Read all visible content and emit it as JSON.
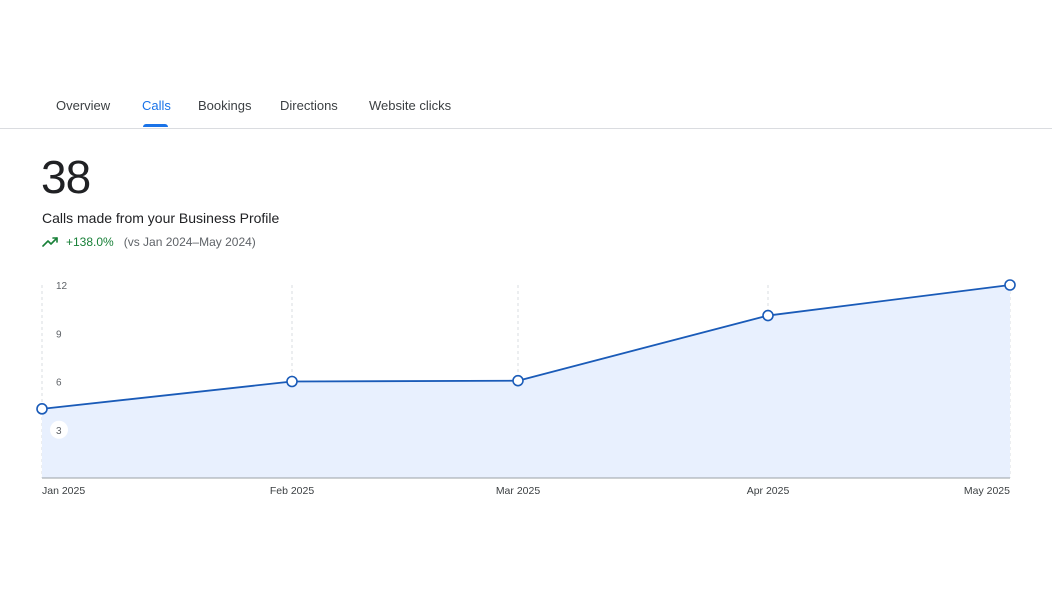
{
  "tabs": [
    {
      "label": "Overview",
      "active": false
    },
    {
      "label": "Calls",
      "active": true
    },
    {
      "label": "Bookings",
      "active": false
    },
    {
      "label": "Directions",
      "active": false
    },
    {
      "label": "Website clicks",
      "active": false
    }
  ],
  "metric": {
    "value": "38",
    "label": "Calls made from your Business Profile",
    "change": "+138.0%",
    "comparison": "(vs Jan 2024–May 2024)",
    "trend_icon": "trending-up-icon"
  },
  "colors": {
    "accent": "#1a73e8",
    "line": "#1a5bb8",
    "area": "#e8f0fe",
    "positive": "#188038",
    "grid": "#dadce0"
  },
  "chart_data": {
    "type": "area",
    "x": [
      "Jan 2025",
      "Feb 2025",
      "Mar 2025",
      "Apr 2025",
      "May 2025"
    ],
    "series": [
      {
        "values": [
          4.3,
          6,
          6.05,
          10.1,
          12
        ]
      }
    ],
    "yticks": [
      3,
      6,
      9,
      12
    ],
    "ylim": [
      0,
      12
    ],
    "grid": "vertical dashed",
    "legend": "none"
  }
}
